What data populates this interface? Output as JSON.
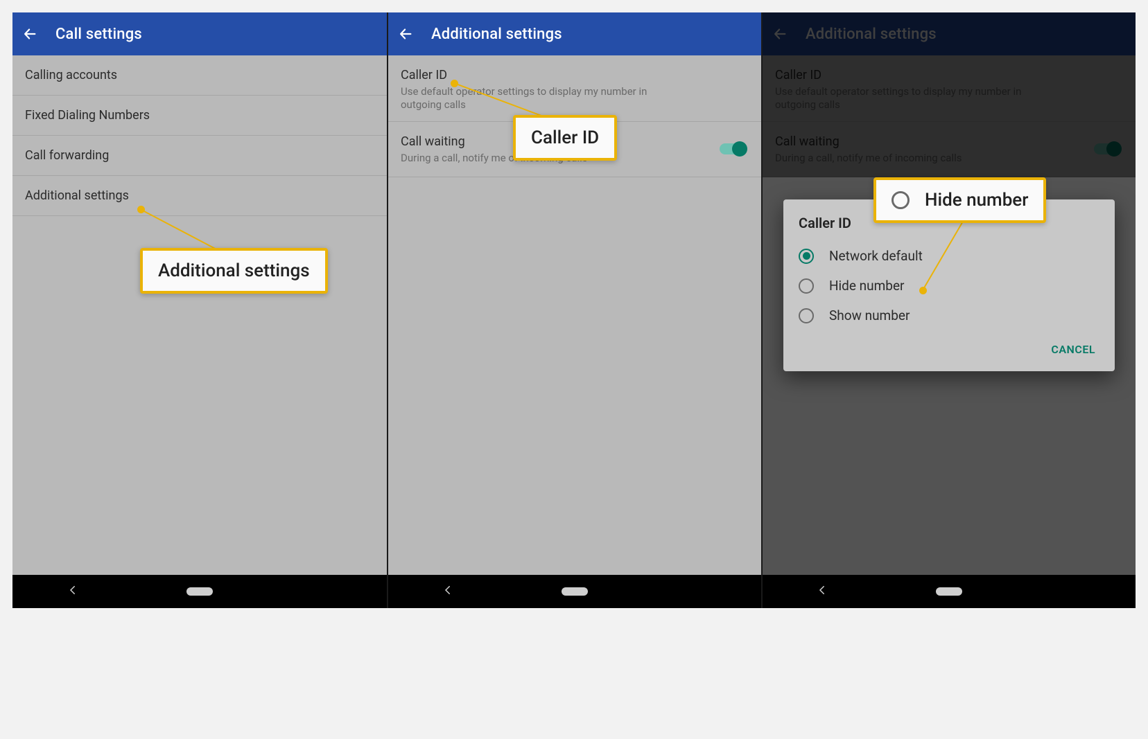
{
  "pane1": {
    "title": "Call settings",
    "items": {
      "0": {
        "label": "Calling accounts"
      },
      "1": {
        "label": "Fixed Dialing Numbers"
      },
      "2": {
        "label": "Call forwarding"
      },
      "3": {
        "label": "Additional settings"
      }
    },
    "callout": "Additional settings"
  },
  "pane2": {
    "title": "Additional settings",
    "callerId": {
      "label": "Caller ID",
      "sub": "Use default operator settings to display my number in outgoing calls"
    },
    "callWaiting": {
      "label": "Call waiting",
      "sub": "During a call, notify me of incoming calls",
      "on": true
    },
    "callout": "Caller ID"
  },
  "pane3": {
    "title": "Additional settings",
    "callerId": {
      "label": "Caller ID",
      "sub": "Use default operator settings to display my number in outgoing calls"
    },
    "callWaiting": {
      "label": "Call waiting",
      "sub": "During a call, notify me of incoming calls",
      "on": true
    },
    "dialog": {
      "title": "Caller ID",
      "options": {
        "0": {
          "label": "Network default",
          "selected": true
        },
        "1": {
          "label": "Hide number",
          "selected": false
        },
        "2": {
          "label": "Show number",
          "selected": false
        }
      },
      "cancel": "CANCEL"
    },
    "callout": "Hide number"
  }
}
